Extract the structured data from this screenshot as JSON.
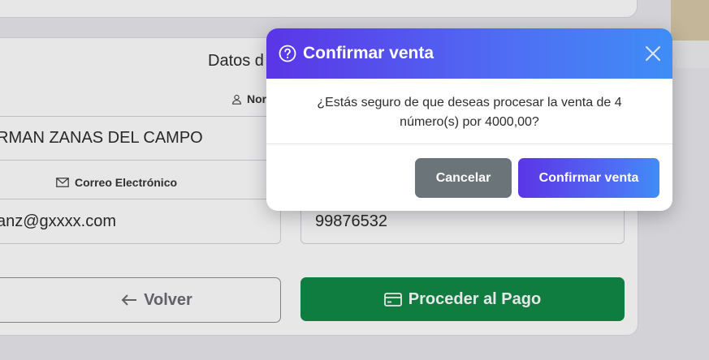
{
  "form": {
    "section_title": "Datos d",
    "name_label": "Nor",
    "name_value": "RMAN ZANAS DEL CAMPO",
    "email_label": "Correo Electrónico",
    "email_value": "anz@gxxxx.com",
    "phone_value": "99876532",
    "back_label": "Volver",
    "pay_label": "Proceder al Pago"
  },
  "icons": {
    "user": "user-icon",
    "mail": "mail-icon",
    "back": "arrow-left-icon",
    "card": "credit-card-icon",
    "question": "question-circle-icon",
    "close": "close-icon"
  },
  "modal": {
    "title": "Confirmar venta",
    "message": "¿Estás seguro de que deseas procesar la venta de 4 número(s) por 4000,00?",
    "cancel_label": "Cancelar",
    "confirm_label": "Confirmar venta"
  },
  "colors": {
    "primary_gradient_start": "#5b35e6",
    "primary_gradient_end": "#3f8df6",
    "success": "#0f8a45",
    "secondary": "#6b7479"
  }
}
